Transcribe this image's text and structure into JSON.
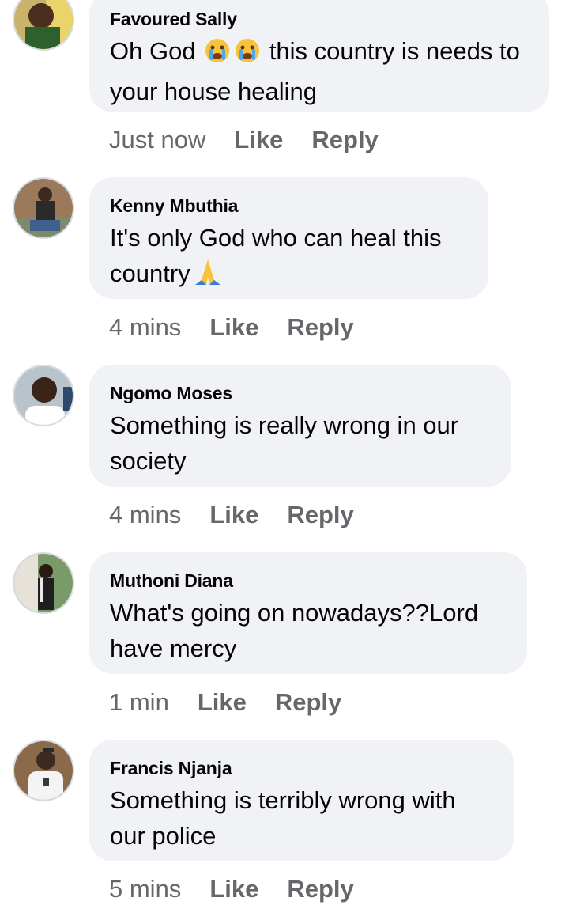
{
  "comments": [
    {
      "name": "Favoured Sally",
      "text_before_emoji": "Oh God",
      "text_after_emoji": "this country is needs to your house healing",
      "emojis": [
        "crying-face-icon",
        "crying-face-icon"
      ],
      "time": "Just now",
      "like_label": "Like",
      "reply_label": "Reply"
    },
    {
      "name": "Kenny Mbuthia",
      "text": "It's only God who can heal this country",
      "emojis": [
        "folded-hands-icon"
      ],
      "time": "4 mins",
      "like_label": "Like",
      "reply_label": "Reply"
    },
    {
      "name": "Ngomo Moses",
      "text": "Something is really wrong in our society",
      "time": "4 mins",
      "like_label": "Like",
      "reply_label": "Reply"
    },
    {
      "name": "Muthoni Diana",
      "text": "What's going on nowadays??Lord have mercy",
      "time": "1 min",
      "like_label": "Like",
      "reply_label": "Reply"
    },
    {
      "name": "Francis Njanja",
      "text": "Something is terribly wrong with our police",
      "time": "5 mins",
      "like_label": "Like",
      "reply_label": "Reply"
    }
  ],
  "colors": {
    "bubble_bg": "#f0f2f5",
    "text": "#050505",
    "meta": "#65676b"
  }
}
